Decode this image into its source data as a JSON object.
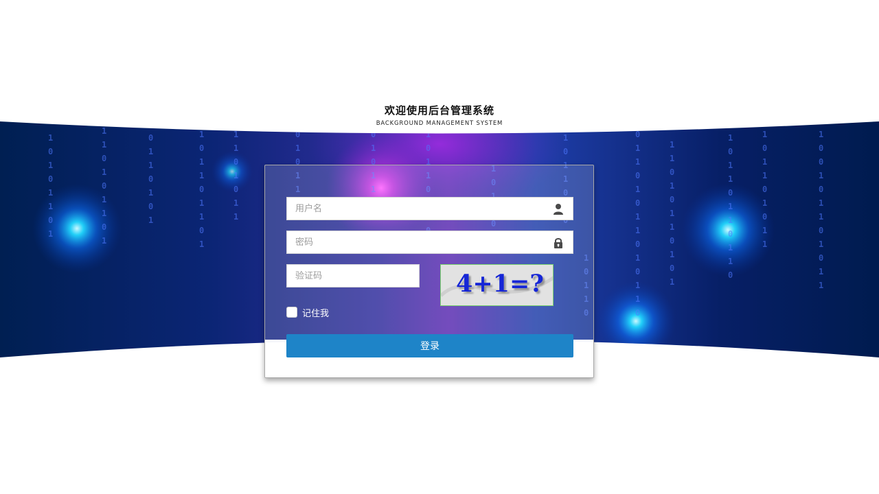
{
  "header": {
    "title": "欢迎使用后台管理系统",
    "subtitle": "BACKGROUND MANAGEMENT SYSTEM"
  },
  "form": {
    "username_placeholder": "用户名",
    "username_value": "",
    "password_placeholder": "密码",
    "password_value": "",
    "captcha_placeholder": "验证码",
    "captcha_value": "",
    "captcha_text": "4+1=?",
    "remember_label": "记住我",
    "remember_checked": false,
    "submit_label": "登录"
  },
  "icons": {
    "username": "user-icon",
    "password": "lock-icon"
  },
  "colors": {
    "banner_dark": "#00184d",
    "banner_blue": "#2140b8",
    "banner_purple": "#7d1fb8",
    "glow_cyan": "#1ad4ff",
    "button": "#1e84c8",
    "captcha_border": "#79d46b"
  }
}
